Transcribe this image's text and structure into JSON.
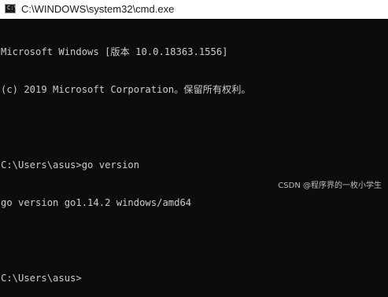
{
  "window": {
    "title": "C:\\WINDOWS\\system32\\cmd.exe",
    "icon": "console-app-icon"
  },
  "console": {
    "lines": [
      "Microsoft Windows [版本 10.0.18363.1556]",
      "(c) 2019 Microsoft Corporation。保留所有权利。",
      "",
      "C:\\Users\\asus>go version",
      "go version go1.14.2 windows/amd64",
      "",
      "C:\\Users\\asus>"
    ],
    "text_color": "#cccccc",
    "background_color": "#0c0c0c"
  },
  "watermark": "CSDN @程序界的一枚小学生"
}
